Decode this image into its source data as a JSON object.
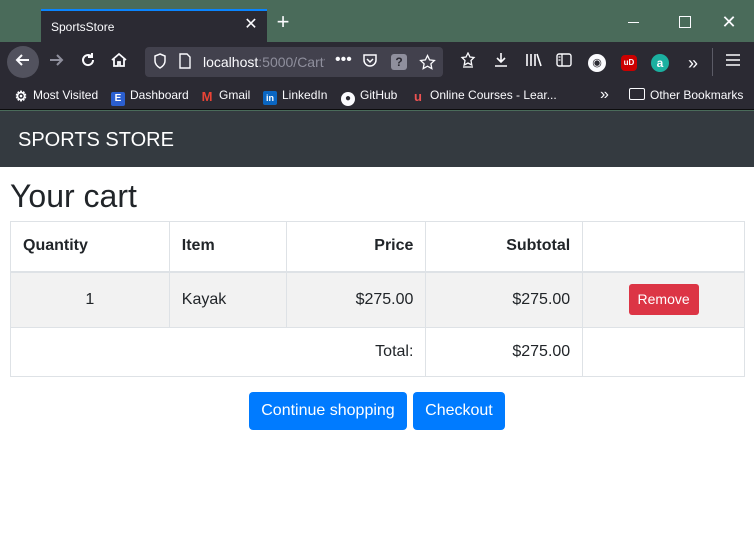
{
  "browser": {
    "tab_title": "SportsStore",
    "tab_close": "✕",
    "new_tab": "+",
    "window_close": "✕",
    "url_host": "localhost",
    "url_rest": ":5000/Cart?",
    "url_menu": "•••",
    "help_badge": "?",
    "bookmarks": {
      "most_visited": "Most Visited",
      "dashboard": "Dashboard",
      "gmail": "Gmail",
      "linkedin": "LinkedIn",
      "github": "GitHub",
      "online_courses": "Online Courses - Lear...",
      "other_bookmarks": "Other Bookmarks"
    },
    "icons": {
      "back": "arrow-left-icon",
      "forward": "arrow-right-icon",
      "reload": "reload-icon",
      "home": "home-icon",
      "ext_ud": "uD",
      "ext_a": "a"
    }
  },
  "site": {
    "brand": "SPORTS STORE"
  },
  "cart": {
    "heading": "Your cart",
    "columns": {
      "quantity": "Quantity",
      "item": "Item",
      "price": "Price",
      "subtotal": "Subtotal"
    },
    "lines": [
      {
        "quantity": "1",
        "item": "Kayak",
        "price": "$275.00",
        "subtotal": "$275.00",
        "remove_label": "Remove"
      }
    ],
    "total_label": "Total:",
    "total_value": "$275.00"
  },
  "actions": {
    "continue_label": "Continue shopping",
    "checkout_label": "Checkout"
  },
  "colors": {
    "header_bg": "#343a40",
    "primary": "#007bff",
    "danger": "#dc3545",
    "striped_row": "#f2f2f2",
    "browser_chrome": "#2b2a33",
    "titlebar": "#4a6b5a"
  }
}
